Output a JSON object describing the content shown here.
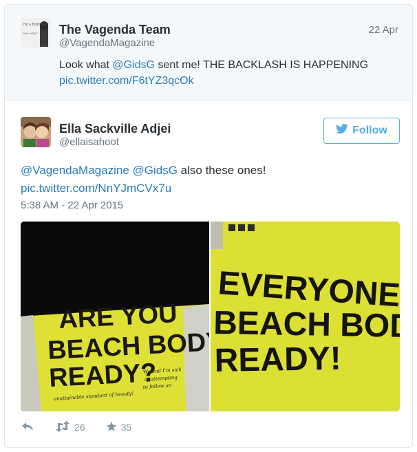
{
  "parent_tweet": {
    "name": "The Vagenda Team",
    "handle": "@VagendaMagazine",
    "date": "22 Apr",
    "text_pre": "Look what ",
    "mention": "@GidsG",
    "text_post": " sent me! THE BACKLASH IS HAPPENING",
    "link": "pic.twitter.com/F6tYZ3qcOk"
  },
  "tweet": {
    "name": "Ella Sackville Adjei",
    "handle": "@ellaisahoot",
    "follow_label": "Follow",
    "mention1": "@VagendaMagazine",
    "mention2": "@GidsG",
    "text_post": " also these ones!",
    "link": "pic.twitter.com/NnYJmCVx7u",
    "timestamp": "5:38 AM - 22 Apr 2015",
    "photo_left": {
      "line1": "ARE YOU",
      "line2": "BEACH BODY",
      "line3": "READY?",
      "handwritten1": "We and I'm sick",
      "handwritten2": "of attempting",
      "handwritten3": "to follow an",
      "handwritten4": "unattainable standard of beauty!"
    },
    "photo_right": {
      "line1": "EVERYONE IS",
      "line2": "BEACH BODY",
      "line3": "READY!"
    },
    "retweets": "26",
    "favorites": "35"
  },
  "colors": {
    "link": "#2b7bb9",
    "follow": "#55acee",
    "poster_yellow": "#e2e43a",
    "muted": "#8899a6"
  }
}
